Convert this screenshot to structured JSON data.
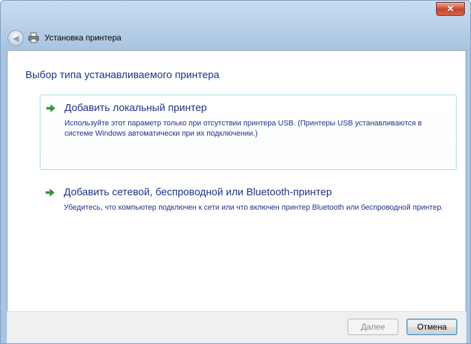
{
  "window": {
    "title": "Установка принтера",
    "close_label": "✕"
  },
  "icons": {
    "back": "back-arrow-icon",
    "printer": "printer-icon",
    "option_arrow": "green-arrow-icon"
  },
  "main": {
    "heading": "Выбор типа устанавливаемого принтера",
    "options": [
      {
        "title": "Добавить локальный принтер",
        "description": "Используйте этот параметр только при отсутствии принтера USB. (Принтеры USB устанавливаются в системе Windows автоматически при их подключении.)"
      },
      {
        "title": "Добавить сетевой, беспроводной или Bluetooth-принтер",
        "description": "Убедитесь, что компьютер подключен к сети или что включен принтер Bluetooth или беспроводной принтер."
      }
    ]
  },
  "footer": {
    "next_label": "Далее",
    "cancel_label": "Отмена"
  },
  "colors": {
    "accent": "#1e3287",
    "arrow": "#2f9e2f"
  }
}
